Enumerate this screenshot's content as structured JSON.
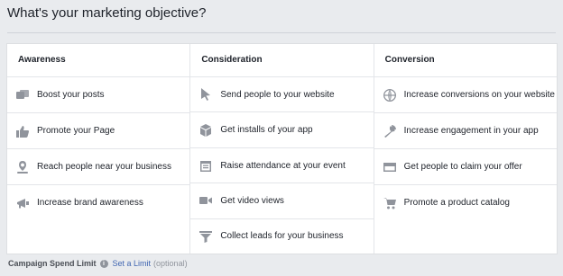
{
  "page": {
    "title": "What's your marketing objective?"
  },
  "columns": [
    {
      "header": "Awareness",
      "options": [
        {
          "label": "Boost your posts",
          "icon": "posts-icon"
        },
        {
          "label": "Promote your Page",
          "icon": "thumbs-up-icon"
        },
        {
          "label": "Reach people near your business",
          "icon": "location-pin-icon"
        },
        {
          "label": "Increase brand awareness",
          "icon": "megaphone-icon"
        }
      ]
    },
    {
      "header": "Consideration",
      "options": [
        {
          "label": "Send people to your website",
          "icon": "cursor-icon"
        },
        {
          "label": "Get installs of your app",
          "icon": "box-icon"
        },
        {
          "label": "Raise attendance at your event",
          "icon": "calendar-icon"
        },
        {
          "label": "Get video views",
          "icon": "video-camera-icon"
        },
        {
          "label": "Collect leads for your business",
          "icon": "funnel-icon"
        }
      ]
    },
    {
      "header": "Conversion",
      "options": [
        {
          "label": "Increase conversions on your website",
          "icon": "globe-icon"
        },
        {
          "label": "Increase engagement in your app",
          "icon": "wrench-icon"
        },
        {
          "label": "Get people to claim your offer",
          "icon": "offer-card-icon"
        },
        {
          "label": "Promote a product catalog",
          "icon": "shopping-cart-icon"
        }
      ]
    }
  ],
  "footer": {
    "label": "Campaign Spend Limit",
    "info_icon": "info-icon",
    "link": "Set a Limit",
    "optional": "(optional)"
  },
  "colors": {
    "icon": "#90949c",
    "link": "#4267b2",
    "background": "#e9ebee"
  }
}
